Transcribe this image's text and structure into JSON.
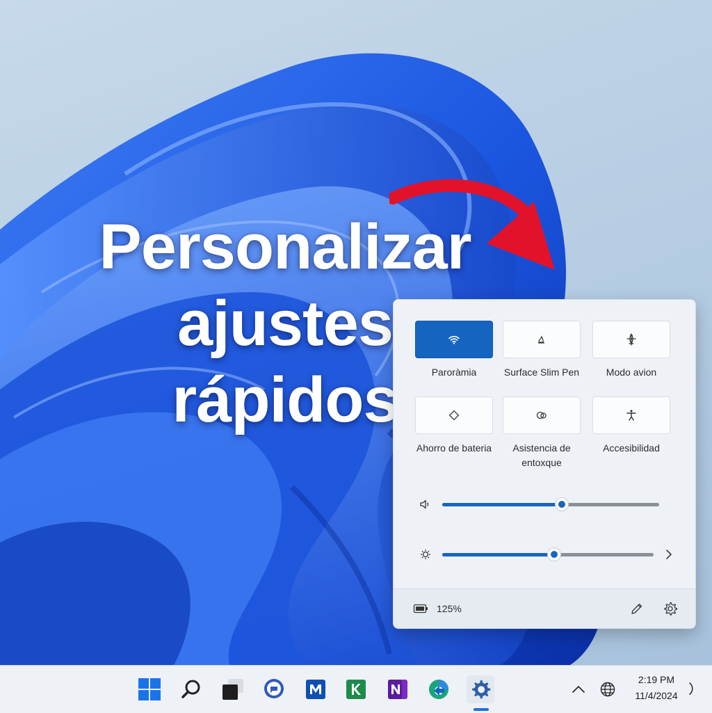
{
  "headline": {
    "line1": "Personalizar",
    "line2": "ajustes",
    "line3": "rápidos"
  },
  "quick_settings": {
    "tiles": [
      {
        "label": "Paroràmia",
        "icon": "wifi-icon",
        "active": true
      },
      {
        "label": "Surface Slim Pen",
        "icon": "pen-icon",
        "active": false
      },
      {
        "label": "Modo avion",
        "icon": "airplane-icon",
        "active": false
      },
      {
        "label": "Ahorro de bateria",
        "icon": "battery-saver-icon",
        "active": false
      },
      {
        "label": "Asistencia de entoxque",
        "label_line1": "Asistencia de",
        "label_line2": "entoxque",
        "icon": "focus-assist-icon",
        "active": false
      },
      {
        "label": "Accesibilidad",
        "icon": "accessibility-icon",
        "active": false
      }
    ],
    "volume": {
      "icon": "speaker-icon",
      "level_percent": 55
    },
    "brightness": {
      "icon": "brightness-icon",
      "level_percent": 53
    },
    "footer": {
      "battery_icon": "battery-icon",
      "battery_text": "125%",
      "edit_icon": "pencil-icon",
      "settings_icon": "gear-icon"
    }
  },
  "taskbar": {
    "apps": [
      "start-icon",
      "search-icon",
      "task-view-icon",
      "chat-icon",
      "outlook-icon",
      "excel-icon",
      "onenote-icon",
      "edge-icon",
      "settings-app-icon"
    ],
    "active_app": "settings-app-icon",
    "tray": {
      "chevron_icon": "chevron-up-icon",
      "language_icon": "globe-icon",
      "time": "2:19 PM",
      "date": "11/4/2024"
    }
  },
  "colors": {
    "accent": "#1565c0",
    "arrow": "#e3122b",
    "wallpaper_blue": "#1f5fe0"
  }
}
